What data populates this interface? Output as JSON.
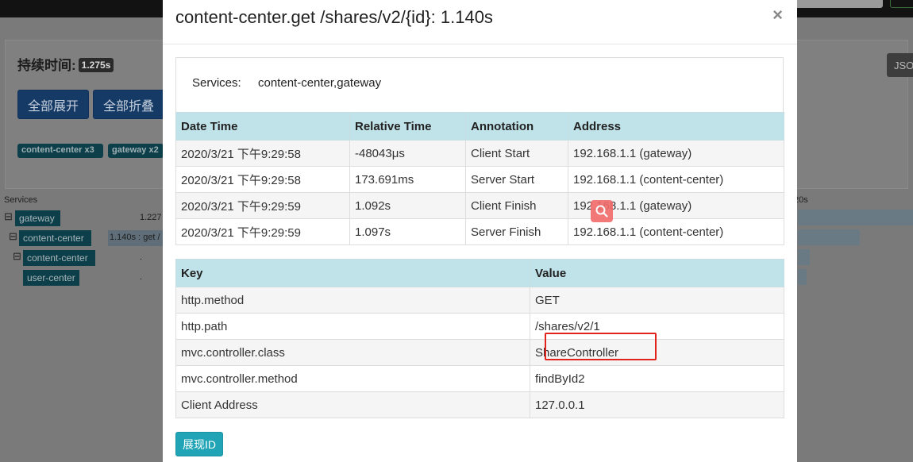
{
  "background": {
    "duration_label": "持续时间:",
    "duration_value": "1.275s",
    "expand_all": "全部展开",
    "collapse_all": "全部折叠",
    "json_button": "JSO",
    "service_tags": [
      "content-center x3",
      "gateway x2"
    ],
    "services_header": "Services",
    "scale_label": "20s",
    "tree": [
      {
        "toggle": "⊟",
        "name": "gateway",
        "info": "1.227"
      },
      {
        "toggle": "⊟",
        "name": "content-center",
        "info": "1.140s : get /"
      },
      {
        "toggle": "⊟",
        "name": "content-center",
        "info": "."
      },
      {
        "toggle": "",
        "name": "user-center",
        "info": "."
      }
    ]
  },
  "modal": {
    "title": "content-center.get /shares/v2/{id}: 1.140s",
    "close_icon": "×",
    "services_label": "Services:",
    "services_value": "content-center,gateway",
    "annotations_table": {
      "headers": [
        "Date Time",
        "Relative Time",
        "Annotation",
        "Address"
      ],
      "rows": [
        [
          "2020/3/21 下午9:29:58",
          "-48043μs",
          "Client Start",
          "192.168.1.1 (gateway)"
        ],
        [
          "2020/3/21 下午9:29:58",
          "173.691ms",
          "Server Start",
          "192.168.1.1 (content-center)"
        ],
        [
          "2020/3/21 下午9:29:59",
          "1.092s",
          "Client Finish",
          "192.168.1.1 (gateway)"
        ],
        [
          "2020/3/21 下午9:29:59",
          "1.097s",
          "Server Finish",
          "192.168.1.1 (content-center)"
        ]
      ]
    },
    "tags_table": {
      "headers": [
        "Key",
        "Value"
      ],
      "rows": [
        [
          "http.method",
          "GET"
        ],
        [
          "http.path",
          "/shares/v2/1"
        ],
        [
          "mvc.controller.class",
          "ShareController"
        ],
        [
          "mvc.controller.method",
          "findById2"
        ],
        [
          "Client Address",
          "127.0.0.1"
        ]
      ]
    },
    "show_id_button": "展现ID"
  },
  "colors": {
    "table_header": "#c0e3ea",
    "button_teal": "#20a4b6",
    "highlight_red": "#e0241c"
  }
}
